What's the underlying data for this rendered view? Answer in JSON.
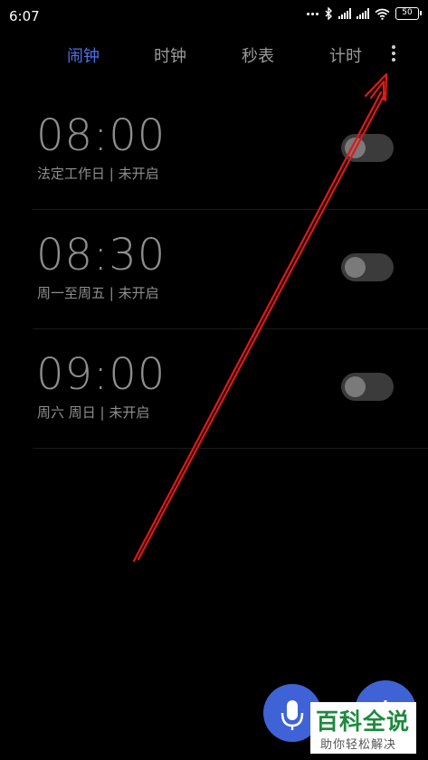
{
  "status_bar": {
    "time": "6:07",
    "battery": "50",
    "icons": [
      "dots-icon",
      "bluetooth-icon",
      "signal-icon",
      "signal-icon",
      "wifi-icon",
      "battery-icon"
    ]
  },
  "tabs": [
    {
      "label": "闹钟",
      "active": true
    },
    {
      "label": "时钟",
      "active": false
    },
    {
      "label": "秒表",
      "active": false
    },
    {
      "label": "计时",
      "active": false
    }
  ],
  "alarms": [
    {
      "time": "08:00",
      "repeat": "法定工作日 | 未开启",
      "enabled": false
    },
    {
      "time": "08:30",
      "repeat": "周一至周五 | 未开启",
      "enabled": false
    },
    {
      "time": "09:00",
      "repeat": "周六 周日 | 未开启",
      "enabled": false
    }
  ],
  "watermark": {
    "main": "百科全说",
    "sub": "助你轻松解决"
  },
  "colors": {
    "accent": "#4e71e6",
    "fab": "#3f63d6",
    "annotation": "#e01818",
    "watermark_green": "#1d8a3f"
  }
}
